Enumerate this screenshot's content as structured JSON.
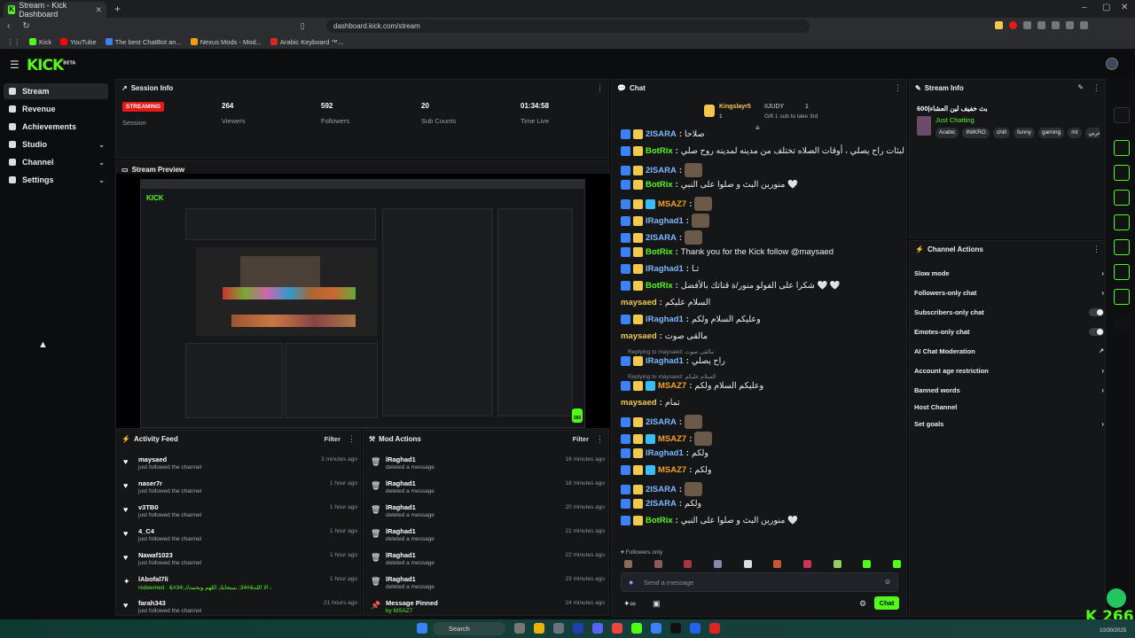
{
  "browser": {
    "tab_title": "Stream - Kick Dashboard",
    "url": "dashboard.kick.com/stream",
    "bookmarks": [
      "Kick",
      "YouTube",
      "The best ChatBot an...",
      "Nexus Mods - Mod...",
      "Arabic Keyboard ™..."
    ]
  },
  "app": {
    "logo": "KICK",
    "logo_sup": "BETA"
  },
  "nav": [
    {
      "label": "Stream"
    },
    {
      "label": "Revenue"
    },
    {
      "label": "Achievements"
    },
    {
      "label": "Studio"
    },
    {
      "label": "Channel"
    },
    {
      "label": "Settings"
    }
  ],
  "session": {
    "title": "Session Info",
    "status": "STREAMING",
    "status_label": "Session",
    "stats": [
      {
        "value": "264",
        "label": "Viewers"
      },
      {
        "value": "592",
        "label": "Followers"
      },
      {
        "value": "20",
        "label": "Sub Counts"
      },
      {
        "value": "01:34:58",
        "label": "Time Live"
      }
    ]
  },
  "preview": {
    "title": "Stream Preview",
    "viewer_badge": "266"
  },
  "activity": {
    "title": "Activity Feed",
    "filter": "Filter",
    "items": [
      {
        "name": "maysaed",
        "sub": "just followed the channel",
        "time": "3 minutes ago"
      },
      {
        "name": "naser7r",
        "sub": "just followed the channel",
        "time": "1 hour ago"
      },
      {
        "name": "v3TB0",
        "sub": "just followed the channel",
        "time": "1 hour ago"
      },
      {
        "name": "4_C4",
        "sub": "just followed the channel",
        "time": "1 hour ago"
      },
      {
        "name": "Nawaf1023",
        "sub": "just followed the channel",
        "time": "1 hour ago"
      },
      {
        "name": "lAbofal7li",
        "sub": "redeemed : &#34;لا اله الا الله&#34; سبحانك اللهم وبحمدك",
        "time": "1 hour ago"
      },
      {
        "name": "farah343",
        "sub": "just followed the channel",
        "time": "21 hours ago"
      }
    ]
  },
  "mod": {
    "title": "Mod Actions",
    "filter": "Filter",
    "items": [
      {
        "name": "lRaghad1",
        "sub": "deleted a message",
        "time": "16 minutes ago"
      },
      {
        "name": "lRaghad1",
        "sub": "deleted a message",
        "time": "18 minutes ago"
      },
      {
        "name": "lRaghad1",
        "sub": "deleted a message",
        "time": "20 minutes ago"
      },
      {
        "name": "lRaghad1",
        "sub": "deleted a message",
        "time": "21 minutes ago"
      },
      {
        "name": "lRaghad1",
        "sub": "deleted a message",
        "time": "22 minutes ago"
      },
      {
        "name": "lRaghad1",
        "sub": "deleted a message",
        "time": "23 minutes ago"
      },
      {
        "name": "Message Pinned",
        "sub": "by MSAZ7",
        "time": "24 minutes ago"
      }
    ]
  },
  "chat": {
    "title": "Chat",
    "top_gifter": "Kingslayr5",
    "top_gifter_count": "1",
    "second_gifter": "IIJUDY",
    "second_count": "1",
    "gift_hint": "Gift 1 sub to take 3rd",
    "messages": [
      {
        "user": "2ISARA",
        "text": "صلاحا"
      },
      {
        "user": "BotRix",
        "text": "البثات راح يصلي ، أوقات الصلاه تختلف من مدينه لمدينه روح صلي"
      },
      {
        "user": "2ISARA",
        "text": ""
      },
      {
        "user": "BotRix",
        "text": "منورين البث و صلوا على النبي 🤍"
      },
      {
        "user": "MSAZ7",
        "text": ""
      },
      {
        "user": "lRaghad1",
        "text": ""
      },
      {
        "user": "2ISARA",
        "text": ""
      },
      {
        "user": "BotRix",
        "text": "Thank you for the Kick follow @maysaed"
      },
      {
        "user": "lRaghad1",
        "text": "تـا"
      },
      {
        "user": "BotRix",
        "text": "شكرا على الفولو منور/ة قناتك بالأفضل 🤍 🤍"
      },
      {
        "user": "maysaed",
        "text": "السلام عليكم"
      },
      {
        "user": "lRaghad1",
        "text": "وعليكم السلام ولكم"
      },
      {
        "user": "maysaed",
        "text": "مالقى صوت"
      },
      {
        "reply": "Replying to maysaed: مالقى صوت",
        "user": "lRaghad1",
        "text": "راح يصلي"
      },
      {
        "reply": "Replying to maysaed: السلام عليكم",
        "user": "MSAZ7",
        "text": "وعليكم السلام ولكم"
      },
      {
        "user": "maysaed",
        "text": "تمام"
      },
      {
        "user": "2ISARA",
        "text": ""
      },
      {
        "user": "MSAZ7",
        "text": ""
      },
      {
        "user": "lRaghad1",
        "text": "ولكم"
      },
      {
        "user": "MSAZ7",
        "text": "ولكم"
      },
      {
        "user": "2ISARA",
        "text": ""
      },
      {
        "user": "2ISARA",
        "text": "ولكم"
      },
      {
        "user": "BotRix",
        "text": "منورين البث و صلوا على النبي 🤍"
      }
    ],
    "followers_only": "Followers only",
    "input_placeholder": "Send a message",
    "send": "Chat"
  },
  "streaminfo": {
    "title": "Stream Info",
    "stream_title": "600|بث خفيف لين العشاء",
    "category": "Just Chatting",
    "tags": [
      "Arabic",
      "INIKRO",
      "chill",
      "funny",
      "gaming",
      "mt",
      "عربي"
    ]
  },
  "channel_actions": {
    "title": "Channel Actions",
    "items": [
      {
        "label": "Slow mode",
        "kind": "arrow"
      },
      {
        "label": "Followers-only chat",
        "kind": "arrow"
      },
      {
        "label": "Subscribers-only chat",
        "kind": "toggle"
      },
      {
        "label": "Emotes-only chat",
        "kind": "toggle"
      },
      {
        "label": "AI Chat Moderation",
        "kind": "ext"
      },
      {
        "label": "Account age restriction",
        "kind": "arrow"
      },
      {
        "label": "Banned words",
        "kind": "arrow"
      },
      {
        "label": "Host Channel",
        "kind": "none"
      },
      {
        "label": "Set goals",
        "kind": "arrow"
      }
    ]
  },
  "overlay_viewers": "266",
  "taskbar": {
    "search": "Search",
    "time": "10/30/2025"
  },
  "colors": {
    "accent": "#53fc18",
    "streaming": "#e91916",
    "username_blue": "#7ab8ff",
    "username_orange": "#f6a21a",
    "username_gold": "#f2c94c"
  }
}
